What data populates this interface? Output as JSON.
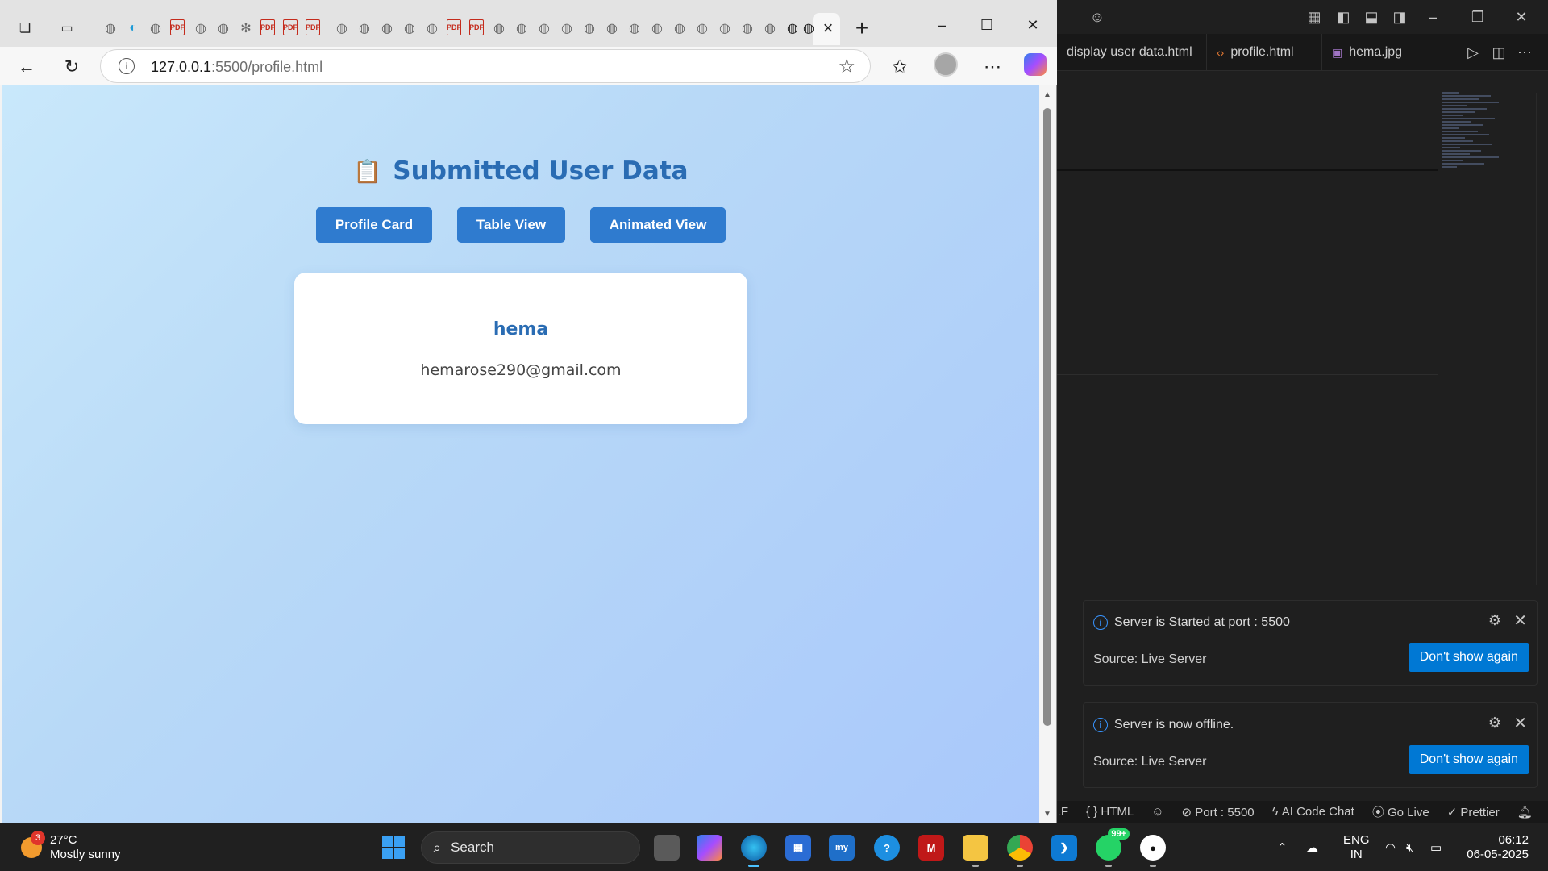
{
  "browser": {
    "address_host": "127.0.0.1",
    "address_path": ":5500/profile.html",
    "tab_close_glyph": "×",
    "new_tab_glyph": "+"
  },
  "page": {
    "title": "Submitted User Data",
    "title_emoji": "📋",
    "buttons": [
      {
        "label": "Profile Card"
      },
      {
        "label": "Table View"
      },
      {
        "label": "Animated View"
      }
    ],
    "card": {
      "name": "hema",
      "email": "hemarose290@gmail.com"
    }
  },
  "vscode": {
    "tabs": [
      {
        "label": "display user data.html",
        "icon": "html-file-icon"
      },
      {
        "label": "profile.html",
        "icon": "html-code-icon"
      },
      {
        "label": "hema.jpg",
        "icon": "image-file-icon"
      }
    ],
    "notifications": [
      {
        "message": "Server is Started at port : 5500",
        "source": "Source: Live Server",
        "action": "Don't show again"
      },
      {
        "message": "Server is now offline.",
        "source": "Source: Live Server",
        "action": "Don't show again"
      }
    ],
    "statusbar": [
      {
        "label": "LF"
      },
      {
        "label": "{ } HTML"
      },
      {
        "label": "⊘ Port : 5500"
      },
      {
        "label": "ϟ AI Code Chat"
      },
      {
        "label": "⦿ Go Live"
      },
      {
        "label": "✓ Prettier"
      }
    ]
  },
  "taskbar": {
    "weather_temp": "27°C",
    "weather_desc": "Mostly sunny",
    "weather_badge": "3",
    "search_placeholder": "Search",
    "whatsapp_count": "99+",
    "lang_top": "ENG",
    "lang_bottom": "IN",
    "time": "06:12",
    "date": "06-05-2025"
  },
  "colors": {
    "accent_button": "#2f7bcf",
    "title_blue": "#2a6cb3",
    "vscode_action": "#0078d4"
  }
}
